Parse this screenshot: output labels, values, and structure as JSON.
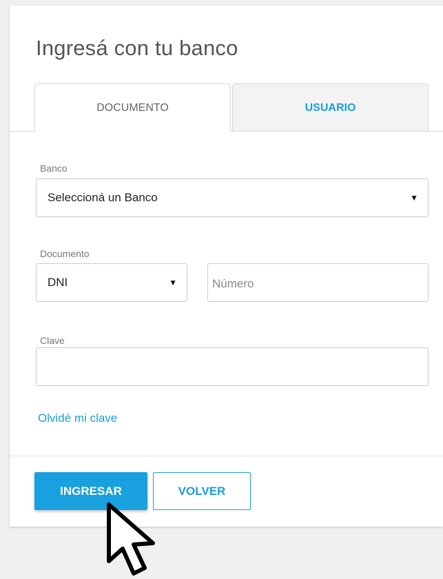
{
  "login": {
    "title": "Ingresá con tu banco",
    "tabs": [
      {
        "label": "DOCUMENTO",
        "active": true
      },
      {
        "label": "USUARIO",
        "active": false
      }
    ],
    "bank": {
      "label": "Banco",
      "selected": "Seleccioná un Banco"
    },
    "document": {
      "label": "Documento",
      "type_selected": "DNI",
      "number_placeholder": "Número"
    },
    "password": {
      "label": "Clave",
      "value": ""
    },
    "forgot_link": "Olvidé mi clave",
    "buttons": {
      "submit": "INGRESAR",
      "back": "VOLVER"
    }
  },
  "colors": {
    "accent": "#19a0de",
    "background": "#eef0f1"
  },
  "icons": {
    "dropdown": "caret-down-icon",
    "pointer": "mouse-pointer-icon"
  }
}
